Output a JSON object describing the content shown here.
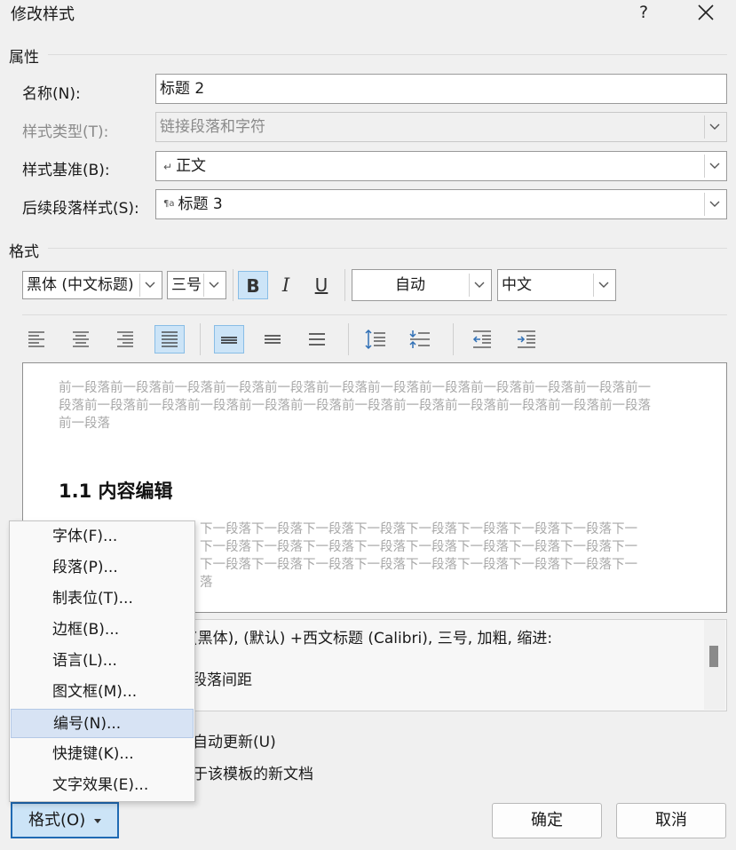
{
  "dialog": {
    "title": "修改样式",
    "help": "?",
    "close": "✕"
  },
  "properties": {
    "section": "属性",
    "name_label": "名称(N):",
    "name_value": "标题 2",
    "type_label": "样式类型(T):",
    "type_value": "链接段落和字符",
    "based_label": "样式基准(B):",
    "based_value": "正文",
    "based_glyph": "↵",
    "next_label": "后续段落样式(S):",
    "next_value": "标题 3",
    "next_glyph": "¶a"
  },
  "format": {
    "section": "格式",
    "font": "黑体 (中文标题)",
    "size": "三号",
    "bold": "B",
    "italic": "I",
    "underline": "U",
    "color": "自动",
    "language": "中文"
  },
  "preview": {
    "prev_para": "前一段落前一段落前一段落前一段落前一段落前一段落前一段落前一段落前一段落前一段落前一段落前一段落前一段落前一段落前一段落前一段落前一段落前一段落前一段落前一段落前一段落前一段落前一段落前一段落",
    "heading": "1.1 内容编辑",
    "next_line1": "下一段落下一段落下一段落下一段落下一段落下一段落下一段落下一段落下一",
    "next_line2": "下一段落下一段落下一段落下一段落下一段落下一段落下一段落下一段落下一",
    "next_line3": "下一段落下一段落下一段落下一段落下一段落下一段落下一段落下一段落下一",
    "next_line4": "落"
  },
  "description": {
    "line1": "(黑体), (默认) +西文标题 (Calibri), 三号, 加粗, 缩进:",
    "line2": "段落间距"
  },
  "options": {
    "auto_update": "自动更新(U)",
    "new_docs": "于该模板的新文档"
  },
  "menu": {
    "items": [
      {
        "label": "字体(F)..."
      },
      {
        "label": "段落(P)..."
      },
      {
        "label": "制表位(T)..."
      },
      {
        "label": "边框(B)..."
      },
      {
        "label": "语言(L)..."
      },
      {
        "label": "图文框(M)..."
      },
      {
        "label": "编号(N)..."
      },
      {
        "label": "快捷键(K)..."
      },
      {
        "label": "文字效果(E)..."
      }
    ],
    "highlighted_index": 6
  },
  "buttons": {
    "format": "格式(O)",
    "ok": "确定",
    "cancel": "取消"
  },
  "colors": {
    "accent": "#1f6ab3",
    "active_bg": "#cce4f7",
    "preview_gray": "#a8a8a8"
  }
}
